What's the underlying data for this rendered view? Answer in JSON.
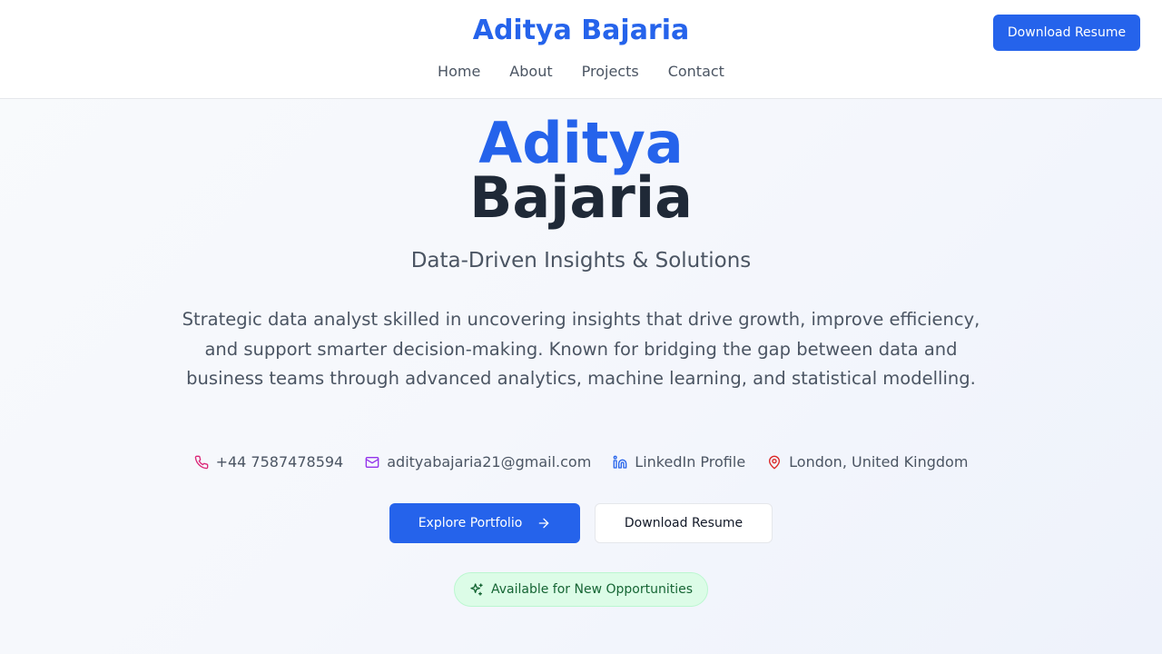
{
  "header": {
    "brand": "Aditya Bajaria",
    "nav": [
      {
        "label": "Home"
      },
      {
        "label": "About"
      },
      {
        "label": "Projects"
      },
      {
        "label": "Contact"
      }
    ],
    "download_label": "Download Resume"
  },
  "hero": {
    "first_name": "Aditya",
    "last_name": "Bajaria",
    "tagline": "Data-Driven Insights & Solutions",
    "summary": "Strategic data analyst skilled in uncovering insights that drive growth, improve efficiency, and support smarter decision-making. Known for bridging the gap between data and business teams through advanced analytics, machine learning, and statistical modelling.",
    "contacts": [
      {
        "icon": "phone-icon",
        "text": "+44 7587478594",
        "color": "#db2777"
      },
      {
        "icon": "mail-icon",
        "text": "adityabajaria21@gmail.com",
        "color": "#9333ea"
      },
      {
        "icon": "linkedin-icon",
        "text": "LinkedIn Profile",
        "color": "#2563eb"
      },
      {
        "icon": "map-pin-icon",
        "text": "London, United Kingdom",
        "color": "#dc2626"
      }
    ],
    "cta_primary": "Explore Portfolio",
    "cta_secondary": "Download Resume",
    "badge": "Available for New Opportunities"
  },
  "colors": {
    "accent": "#2563eb",
    "heading": "#1f2937",
    "body_text": "#4b5563",
    "badge_bg": "#dcfce7",
    "badge_text": "#166534"
  }
}
